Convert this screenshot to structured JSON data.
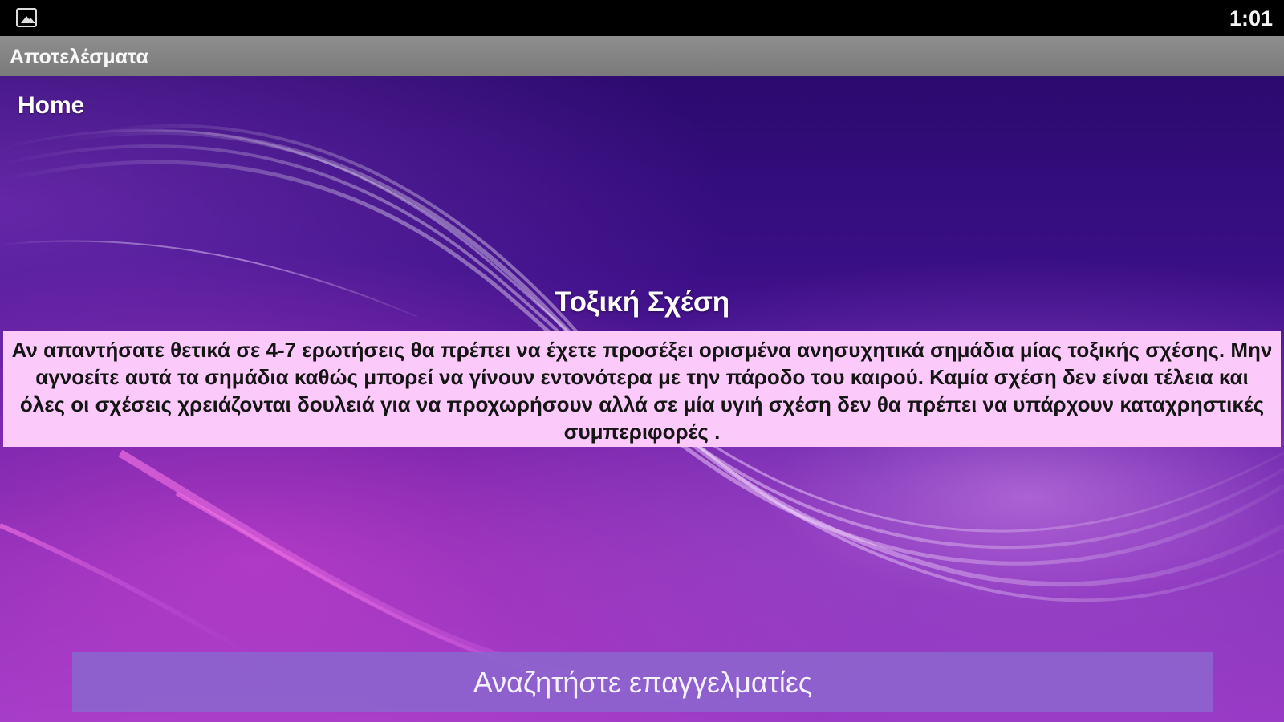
{
  "status_bar": {
    "left_icon": "image-icon",
    "time": "1:01"
  },
  "action_bar": {
    "title": "Αποτελέσματα"
  },
  "main": {
    "home_link": "Home",
    "result_title": "Τοξική Σχέση",
    "result_text": "Αν απαντήσατε θετικά σε 4-7 ερωτήσεις θα πρέπει να έχετε προσέξει ορισμένα ανησυχητικά σημάδια μίας τοξικής σχέσης. Μην αγνοείτε αυτά τα σημάδια καθώς μπορεί να γίνουν εντονότερα με την πάροδο του καιρού. Καμία σχέση δεν είναι τέλεια και όλες οι σχέσεις χρειάζονται δουλειά για να προχωρήσουν αλλά σε μία υγιή σχέση δεν θα πρέπει να υπάρχουν καταχρηστικές συμπεριφορές .",
    "search_button_label": "Αναζητήστε επαγγελματίες"
  },
  "colors": {
    "result_box_bg": "#fcc9fb",
    "button_bg": "#8c64cd",
    "action_bar_bg": "#888888"
  }
}
